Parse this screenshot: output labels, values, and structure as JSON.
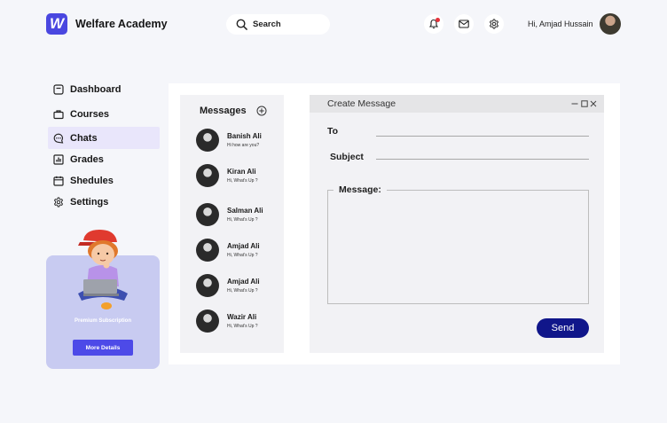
{
  "header": {
    "brand_letter": "W",
    "brand_name": "Welfare Academy",
    "search_label": "Search",
    "greeting": "Hi, Amjad Hussain"
  },
  "sidebar": {
    "items": [
      {
        "label": "Dashboard",
        "icon": "dashboard-icon"
      },
      {
        "label": "Courses",
        "icon": "briefcase-icon"
      },
      {
        "label": "Chats",
        "icon": "chat-icon",
        "active": true
      },
      {
        "label": "Grades",
        "icon": "grades-icon"
      },
      {
        "label": "Shedules",
        "icon": "calendar-icon"
      },
      {
        "label": "Settings",
        "icon": "gear-icon"
      }
    ],
    "promo": {
      "text": "Premium Subscription",
      "button": "More Details"
    }
  },
  "messages": {
    "title": "Messages",
    "list": [
      {
        "name": "Banish Ali",
        "preview": "Hi how are you?"
      },
      {
        "name": "Kiran Ali",
        "preview": "Hi, What's Up ?"
      },
      {
        "name": "Salman Ali",
        "preview": "Hi, What's Up ?"
      },
      {
        "name": "Amjad Ali",
        "preview": "Hi, What's Up ?"
      },
      {
        "name": "Amjad Ali",
        "preview": "Hi, What's Up ?"
      },
      {
        "name": "Wazir Ali",
        "preview": "Hi, What's Up ?"
      }
    ]
  },
  "compose": {
    "title": "Create Message",
    "to_label": "To",
    "to_value": "",
    "subject_label": "Subject",
    "subject_value": "",
    "message_label": "Message:",
    "message_value": "",
    "send_label": "Send"
  },
  "colors": {
    "accent": "#4a47e0",
    "active_nav": "#e9e6fb",
    "promo_bg": "#c8cbf1",
    "send_button": "#10168a",
    "notification": "#e5323b"
  }
}
